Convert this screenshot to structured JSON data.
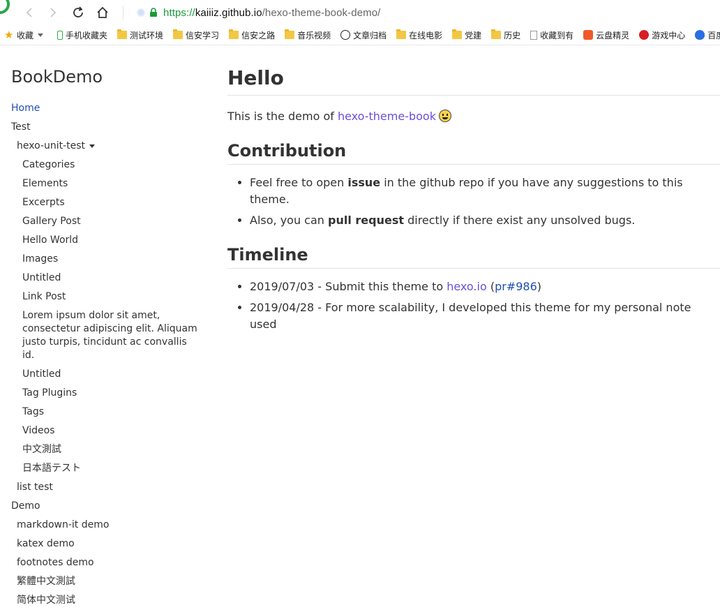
{
  "browser": {
    "url_scheme": "https://",
    "url_host": "kaiiiz.github.io",
    "url_path": "/hexo-theme-book-demo/"
  },
  "bookmarks": [
    {
      "label": "收藏",
      "icon": "star-icon"
    },
    {
      "label": "手机收藏夹",
      "icon": "phone-icon"
    },
    {
      "label": "测试环境",
      "icon": "folder-icon"
    },
    {
      "label": "信安学习",
      "icon": "folder-icon"
    },
    {
      "label": "信安之路",
      "icon": "folder-icon"
    },
    {
      "label": "音乐视频",
      "icon": "folder-icon"
    },
    {
      "label": "文章归档",
      "icon": "smiley-icon"
    },
    {
      "label": "在线电影",
      "icon": "folder-icon"
    },
    {
      "label": "党建",
      "icon": "folder-icon"
    },
    {
      "label": "历史",
      "icon": "folder-icon"
    },
    {
      "label": "收藏到有",
      "icon": "document-icon"
    },
    {
      "label": "云盘精灵",
      "icon": "cloud-icon"
    },
    {
      "label": "游戏中心",
      "icon": "game-icon"
    },
    {
      "label": "百度",
      "icon": "baidu-paw-icon"
    }
  ],
  "sidebar": {
    "brand": "BookDemo",
    "items": [
      {
        "label": "Home",
        "level": 1,
        "active": true
      },
      {
        "label": "Test",
        "level": 1
      },
      {
        "label": "hexo-unit-test",
        "level": 2,
        "expandable": true
      },
      {
        "label": "Categories",
        "level": 3
      },
      {
        "label": "Elements",
        "level": 3
      },
      {
        "label": "Excerpts",
        "level": 3
      },
      {
        "label": "Gallery Post",
        "level": 3
      },
      {
        "label": "Hello World",
        "level": 3
      },
      {
        "label": "Images",
        "level": 3
      },
      {
        "label": "Untitled",
        "level": 3
      },
      {
        "label": "Link Post",
        "level": 3
      },
      {
        "label": "Lorem ipsum dolor sit amet, consectetur adipiscing elit. Aliquam justo turpis, tincidunt ac convallis id.",
        "level": 3
      },
      {
        "label": "Untitled",
        "level": 3
      },
      {
        "label": "Tag Plugins",
        "level": 3
      },
      {
        "label": "Tags",
        "level": 3
      },
      {
        "label": "Videos",
        "level": 3
      },
      {
        "label": "中文測試",
        "level": 3
      },
      {
        "label": "日本語テスト",
        "level": 3
      },
      {
        "label": "list test",
        "level": 2
      },
      {
        "label": "Demo",
        "level": 1
      },
      {
        "label": "markdown-it demo",
        "level": 2
      },
      {
        "label": "katex demo",
        "level": 2
      },
      {
        "label": "footnotes demo",
        "level": 2
      },
      {
        "label": "繁體中文測試",
        "level": 2
      },
      {
        "label": "简体中文测试",
        "level": 2
      }
    ]
  },
  "content": {
    "title": "Hello",
    "intro_text": "This is the demo of ",
    "intro_link": "hexo-theme-book",
    "contribution": {
      "heading": "Contribution",
      "item1_pre": "Feel free to open ",
      "item1_bold": "issue",
      "item1_post": " in the github repo if you have any suggestions to this theme.",
      "item2_pre": "Also, you can ",
      "item2_bold": "pull request",
      "item2_post": " directly if there exist any unsolved bugs."
    },
    "timeline": {
      "heading": "Timeline",
      "item1_pre": "2019/07/03 - Submit this theme to ",
      "item1_link": "hexo.io",
      "item1_mid_open": " (",
      "item1_link2": "pr#986",
      "item1_close": ")",
      "item2": "2019/04/28 - For more scalability, I developed this theme for my personal note used"
    }
  }
}
